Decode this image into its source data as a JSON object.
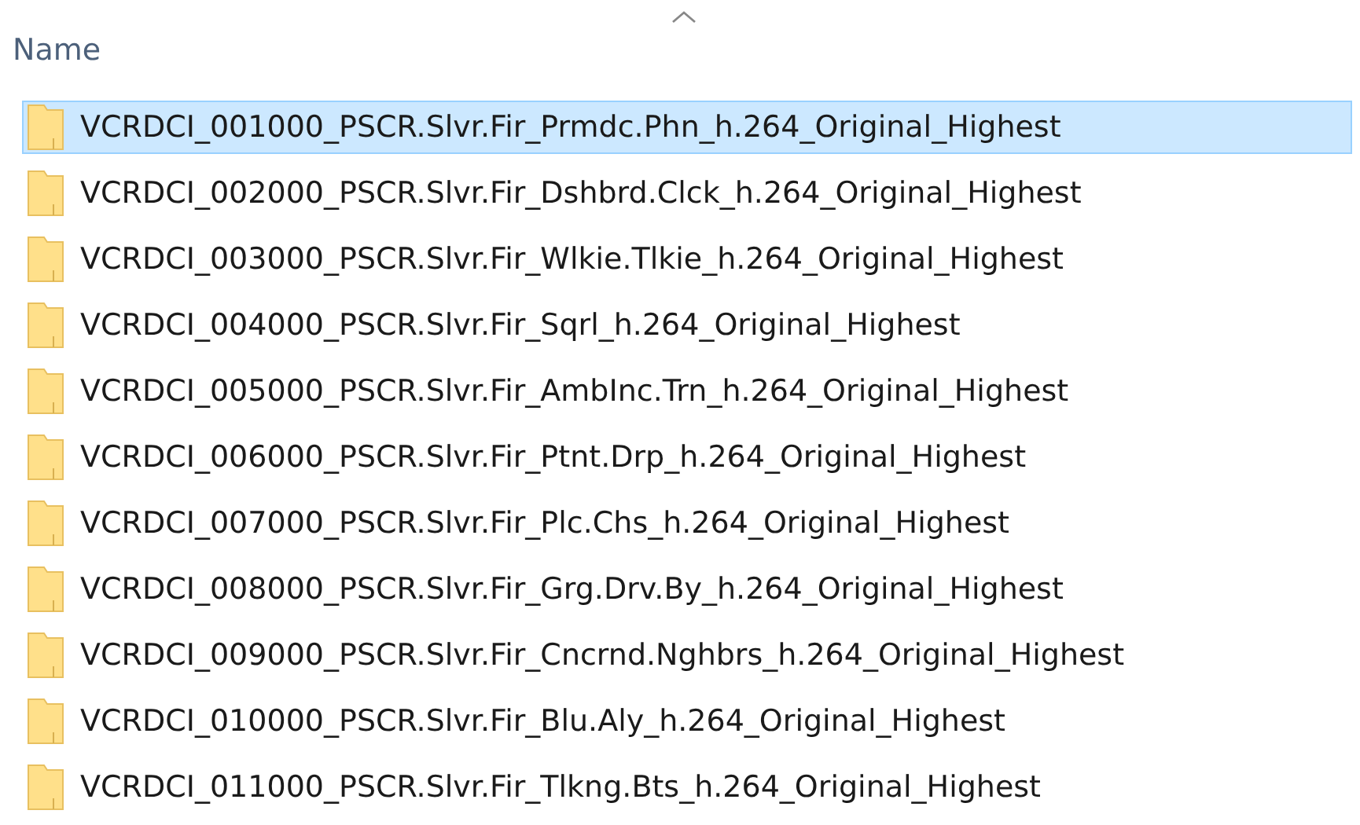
{
  "header": {
    "column_1": "Name",
    "sort_ascending": true
  },
  "rows": [
    {
      "name": "VCRDCI_001000_PSCR.Slvr.Fir_Prmdc.Phn_h.264_Original_Highest",
      "selected": true
    },
    {
      "name": "VCRDCI_002000_PSCR.Slvr.Fir_Dshbrd.Clck_h.264_Original_Highest",
      "selected": false
    },
    {
      "name": "VCRDCI_003000_PSCR.Slvr.Fir_Wlkie.Tlkie_h.264_Original_Highest",
      "selected": false
    },
    {
      "name": "VCRDCI_004000_PSCR.Slvr.Fir_Sqrl_h.264_Original_Highest",
      "selected": false
    },
    {
      "name": "VCRDCI_005000_PSCR.Slvr.Fir_AmbInc.Trn_h.264_Original_Highest",
      "selected": false
    },
    {
      "name": "VCRDCI_006000_PSCR.Slvr.Fir_Ptnt.Drp_h.264_Original_Highest",
      "selected": false
    },
    {
      "name": "VCRDCI_007000_PSCR.Slvr.Fir_Plc.Chs_h.264_Original_Highest",
      "selected": false
    },
    {
      "name": "VCRDCI_008000_PSCR.Slvr.Fir_Grg.Drv.By_h.264_Original_Highest",
      "selected": false
    },
    {
      "name": "VCRDCI_009000_PSCR.Slvr.Fir_Cncrnd.Nghbrs_h.264_Original_Highest",
      "selected": false
    },
    {
      "name": "VCRDCI_010000_PSCR.Slvr.Fir_Blu.Aly_h.264_Original_Highest",
      "selected": false
    },
    {
      "name": "VCRDCI_011000_PSCR.Slvr.Fir_Tlkng.Bts_h.264_Original_Highest",
      "selected": false
    }
  ]
}
